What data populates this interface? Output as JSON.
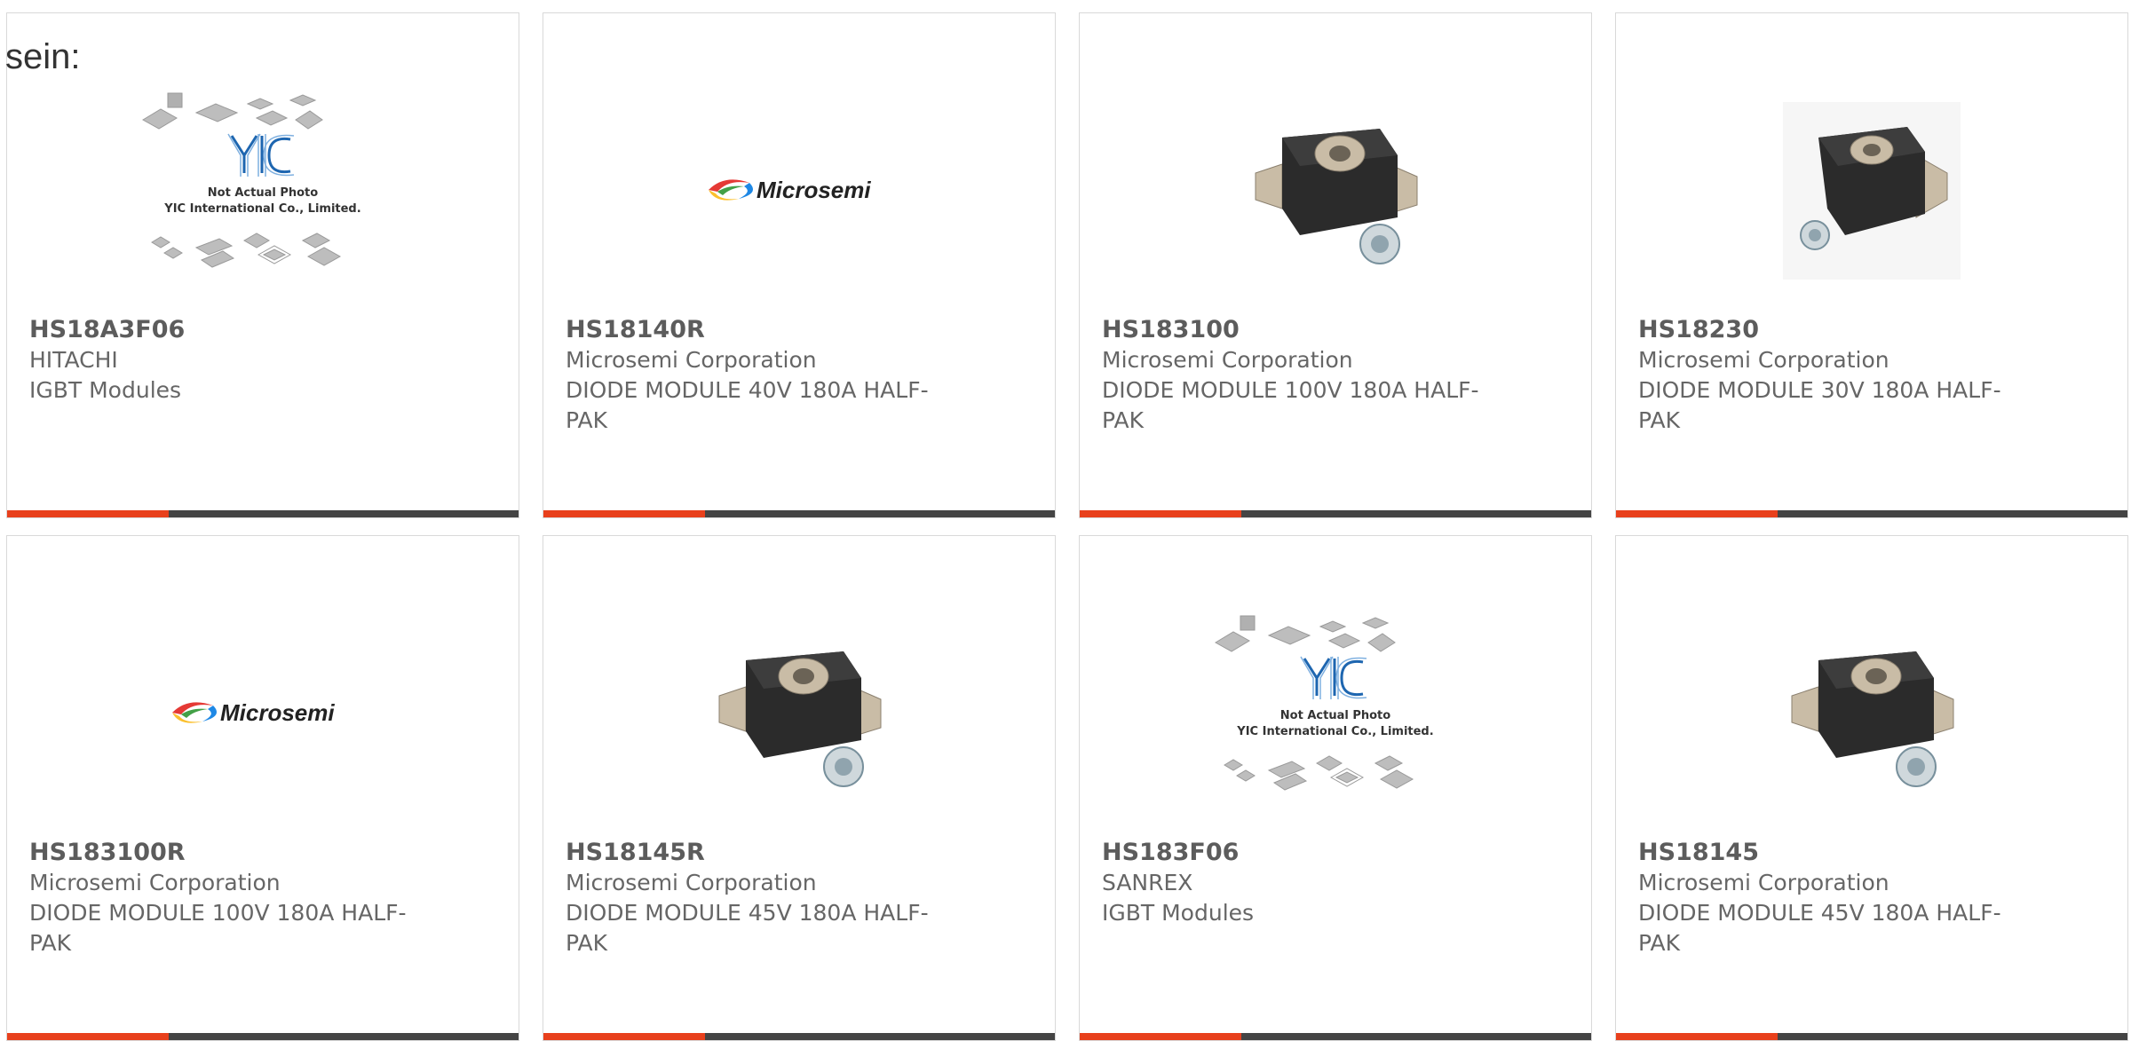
{
  "intro_text": "sein:",
  "colors": {
    "accent": "#e8401c",
    "bar": "#444444"
  },
  "placeholder_overlay": {
    "line1": "Not Actual Photo",
    "line2": "YIC International Co., Limited."
  },
  "microsemi_logo_text": "Microsemi",
  "products": [
    {
      "part": "HS18A3F06",
      "manufacturer": "HITACHI",
      "description": "IGBT Modules",
      "image": "yic-placeholder"
    },
    {
      "part": "HS18140R",
      "manufacturer": "Microsemi Corporation",
      "description": "DIODE MODULE 40V 180A HALF-PAK",
      "image": "microsemi-logo"
    },
    {
      "part": "HS183100",
      "manufacturer": "Microsemi Corporation",
      "description": "DIODE MODULE 100V 180A HALF-PAK",
      "image": "diode-module-photo"
    },
    {
      "part": "HS18230",
      "manufacturer": "Microsemi Corporation",
      "description": "DIODE MODULE 30V 180A HALF-PAK",
      "image": "diode-module-photo"
    },
    {
      "part": "HS183100R",
      "manufacturer": "Microsemi Corporation",
      "description": "DIODE MODULE 100V 180A HALF-PAK",
      "image": "microsemi-logo"
    },
    {
      "part": "HS18145R",
      "manufacturer": "Microsemi Corporation",
      "description": "DIODE MODULE 45V 180A HALF-PAK",
      "image": "diode-module-photo"
    },
    {
      "part": "HS183F06",
      "manufacturer": "SANREX",
      "description": "IGBT Modules",
      "image": "yic-placeholder"
    },
    {
      "part": "HS18145",
      "manufacturer": "Microsemi Corporation",
      "description": "DIODE MODULE 45V 180A HALF-PAK",
      "image": "diode-module-photo"
    }
  ]
}
